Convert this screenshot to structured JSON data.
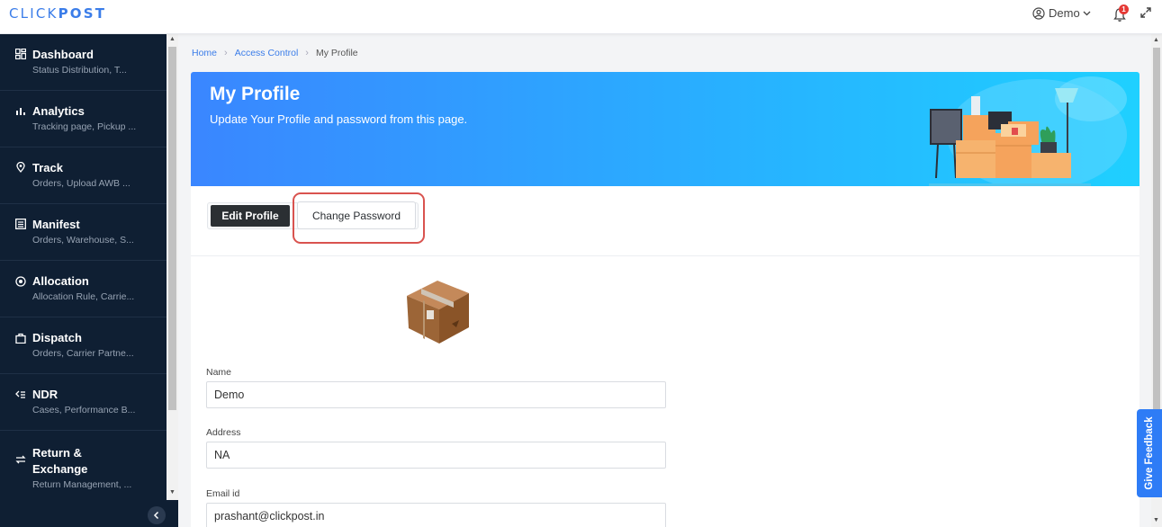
{
  "header": {
    "logo_light": "CLICK",
    "logo_bold": "POST",
    "user_name": "Demo",
    "notification_count": "1"
  },
  "sidebar": {
    "items": [
      {
        "title": "Dashboard",
        "subtitle": "Status Distribution, T...",
        "icon": "dashboard-icon"
      },
      {
        "title": "Analytics",
        "subtitle": "Tracking page, Pickup ...",
        "icon": "bar-chart-icon"
      },
      {
        "title": "Track",
        "subtitle": "Orders, Upload AWB ...",
        "icon": "location-pin-icon"
      },
      {
        "title": "Manifest",
        "subtitle": "Orders, Warehouse, S...",
        "icon": "list-icon"
      },
      {
        "title": "Allocation",
        "subtitle": "Allocation Rule, Carrie...",
        "icon": "target-icon"
      },
      {
        "title": "Dispatch",
        "subtitle": "Orders, Carrier Partne...",
        "icon": "bag-icon"
      },
      {
        "title": "NDR",
        "subtitle": "Cases, Performance B...",
        "icon": "ndr-icon"
      },
      {
        "title": "Return &",
        "title2": "Exchange",
        "subtitle": "Return Management, ...",
        "icon": "swap-icon"
      }
    ]
  },
  "breadcrumb": {
    "home": "Home",
    "access": "Access Control",
    "current": "My Profile"
  },
  "banner": {
    "title": "My Profile",
    "subtitle": "Update Your Profile and password from this page."
  },
  "tabs": {
    "edit": "Edit Profile",
    "password": "Change Password"
  },
  "form": {
    "name_label": "Name",
    "name_value": "Demo",
    "address_label": "Address",
    "address_value": "NA",
    "email_label": "Email id",
    "email_value": "prashant@clickpost.in"
  },
  "feedback": "Give Feedback",
  "colors": {
    "accent": "#3b7de9",
    "sidebar_bg": "#0f1f33",
    "highlight": "#d9534f"
  }
}
